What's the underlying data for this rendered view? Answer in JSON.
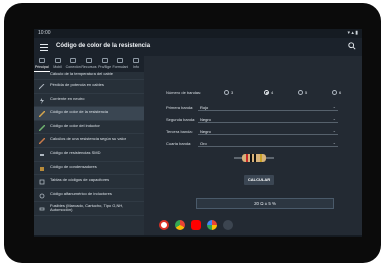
{
  "status": {
    "time": "10:00",
    "right": "▾ ▴ ▮"
  },
  "app": {
    "title": "Código de color de la resistencia"
  },
  "tabs": [
    {
      "label": "Principal"
    },
    {
      "label": "Mobil"
    },
    {
      "label": "Conexión"
    },
    {
      "label": "Recursos"
    },
    {
      "label": "Pro/Bge"
    },
    {
      "label": "Formulario"
    },
    {
      "label": "Info"
    }
  ],
  "sidebar": {
    "items": [
      {
        "label": "Cálculo de la temperatura del cable",
        "icon": "thermometer-icon"
      },
      {
        "label": "Pérdida de potencia en cables",
        "icon": "cable-icon"
      },
      {
        "label": "Corriente en neutro",
        "icon": "lightning-icon"
      },
      {
        "label": "Código de color de la resistencia",
        "icon": "resistor-icon"
      },
      {
        "label": "Código de color del inductor",
        "icon": "inductor-icon"
      },
      {
        "label": "Calcúlos de una resistencia según su valor",
        "icon": "resistor-value-icon"
      },
      {
        "label": "Código de resistencias SMD",
        "icon": "smd-icon"
      },
      {
        "label": "Código de condensadores",
        "icon": "capacitor-icon"
      },
      {
        "label": "Tablas de códigos de capacitores",
        "icon": "table-icon"
      },
      {
        "label": "Código alfanumérico de inductores",
        "icon": "inductor-code-icon"
      },
      {
        "label": "Fusibles (Marcado, Cartucho, Tipo G,NH, Automoción)",
        "icon": "fuse-icon"
      }
    ]
  },
  "form": {
    "bands_label": "Número de bandas:",
    "band_options": [
      "3",
      "4",
      "5",
      "6"
    ],
    "selected_bands": "4",
    "selects": [
      {
        "label": "Primera banda:",
        "value": "Rojo"
      },
      {
        "label": "Segunda banda:",
        "value": "Negro"
      },
      {
        "label": "Tercera banda:",
        "value": "Negro"
      },
      {
        "label": "Cuarta banda:",
        "value": "Oro"
      }
    ],
    "calculate_label": "CALCULAR",
    "result": "20 Ω ± 5 %"
  },
  "colors": {
    "band1": "#c62828",
    "band2": "#111111",
    "band3": "#111111",
    "band4": "#c9a227",
    "resistor_body": "#d8b27a"
  },
  "dock": {
    "apps": [
      "gmail-icon",
      "chrome-icon",
      "youtube-icon",
      "photos-icon",
      "apps-icon"
    ]
  }
}
